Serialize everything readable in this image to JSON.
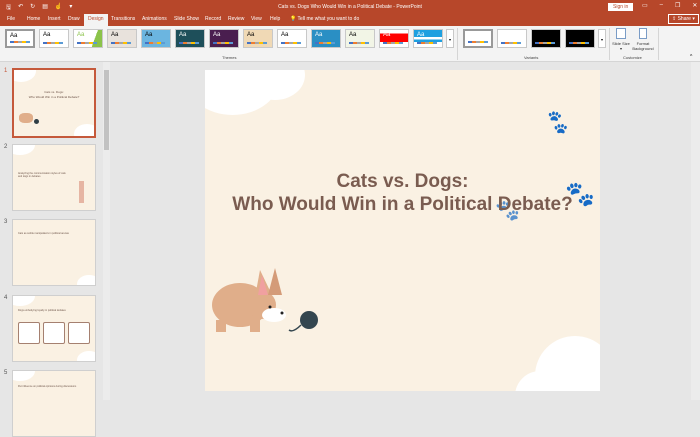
{
  "window": {
    "title": "Cats vs. Dogs Who Would Win in a Political Debate  -  PowerPoint",
    "sign_in": "Sign in",
    "share": "Share"
  },
  "qat": [
    "save-icon",
    "undo-icon",
    "redo-icon",
    "present-icon",
    "touch-mode-icon",
    "customize-icon"
  ],
  "tabs": [
    "File",
    "Home",
    "Insert",
    "Draw",
    "Design",
    "Transitions",
    "Animations",
    "Slide Show",
    "Record",
    "Review",
    "View",
    "Help"
  ],
  "tell_me": "Tell me what you want to do",
  "ribbon": {
    "themes_label": "Themes",
    "variants_label": "Variants",
    "customize_label": "Customize",
    "slide_size": "Slide Size",
    "format_background": "Format Background",
    "theme_sample": "Aa"
  },
  "slides": [
    {
      "num": "1",
      "title": "Cats vs. Dogs:",
      "subtitle": "Who Would Win in a Political Debate?"
    },
    {
      "num": "2",
      "title": "Analyzing the communication styles of cats and dogs in debates"
    },
    {
      "num": "3",
      "title": "Cats as subtle manipulators in political arenas"
    },
    {
      "num": "4",
      "title": "Dogs embodying loyalty in political debates"
    },
    {
      "num": "5",
      "title": "Pet influence on political opinions during discussions"
    }
  ],
  "main_slide": {
    "title_line1": "Cats vs. Dogs:",
    "title_line2": "Who Would Win in a Political Debate?"
  },
  "colors": {
    "accent": "#b7472a",
    "slide_bg": "#faf1e3",
    "title_text": "#7a5c50"
  }
}
